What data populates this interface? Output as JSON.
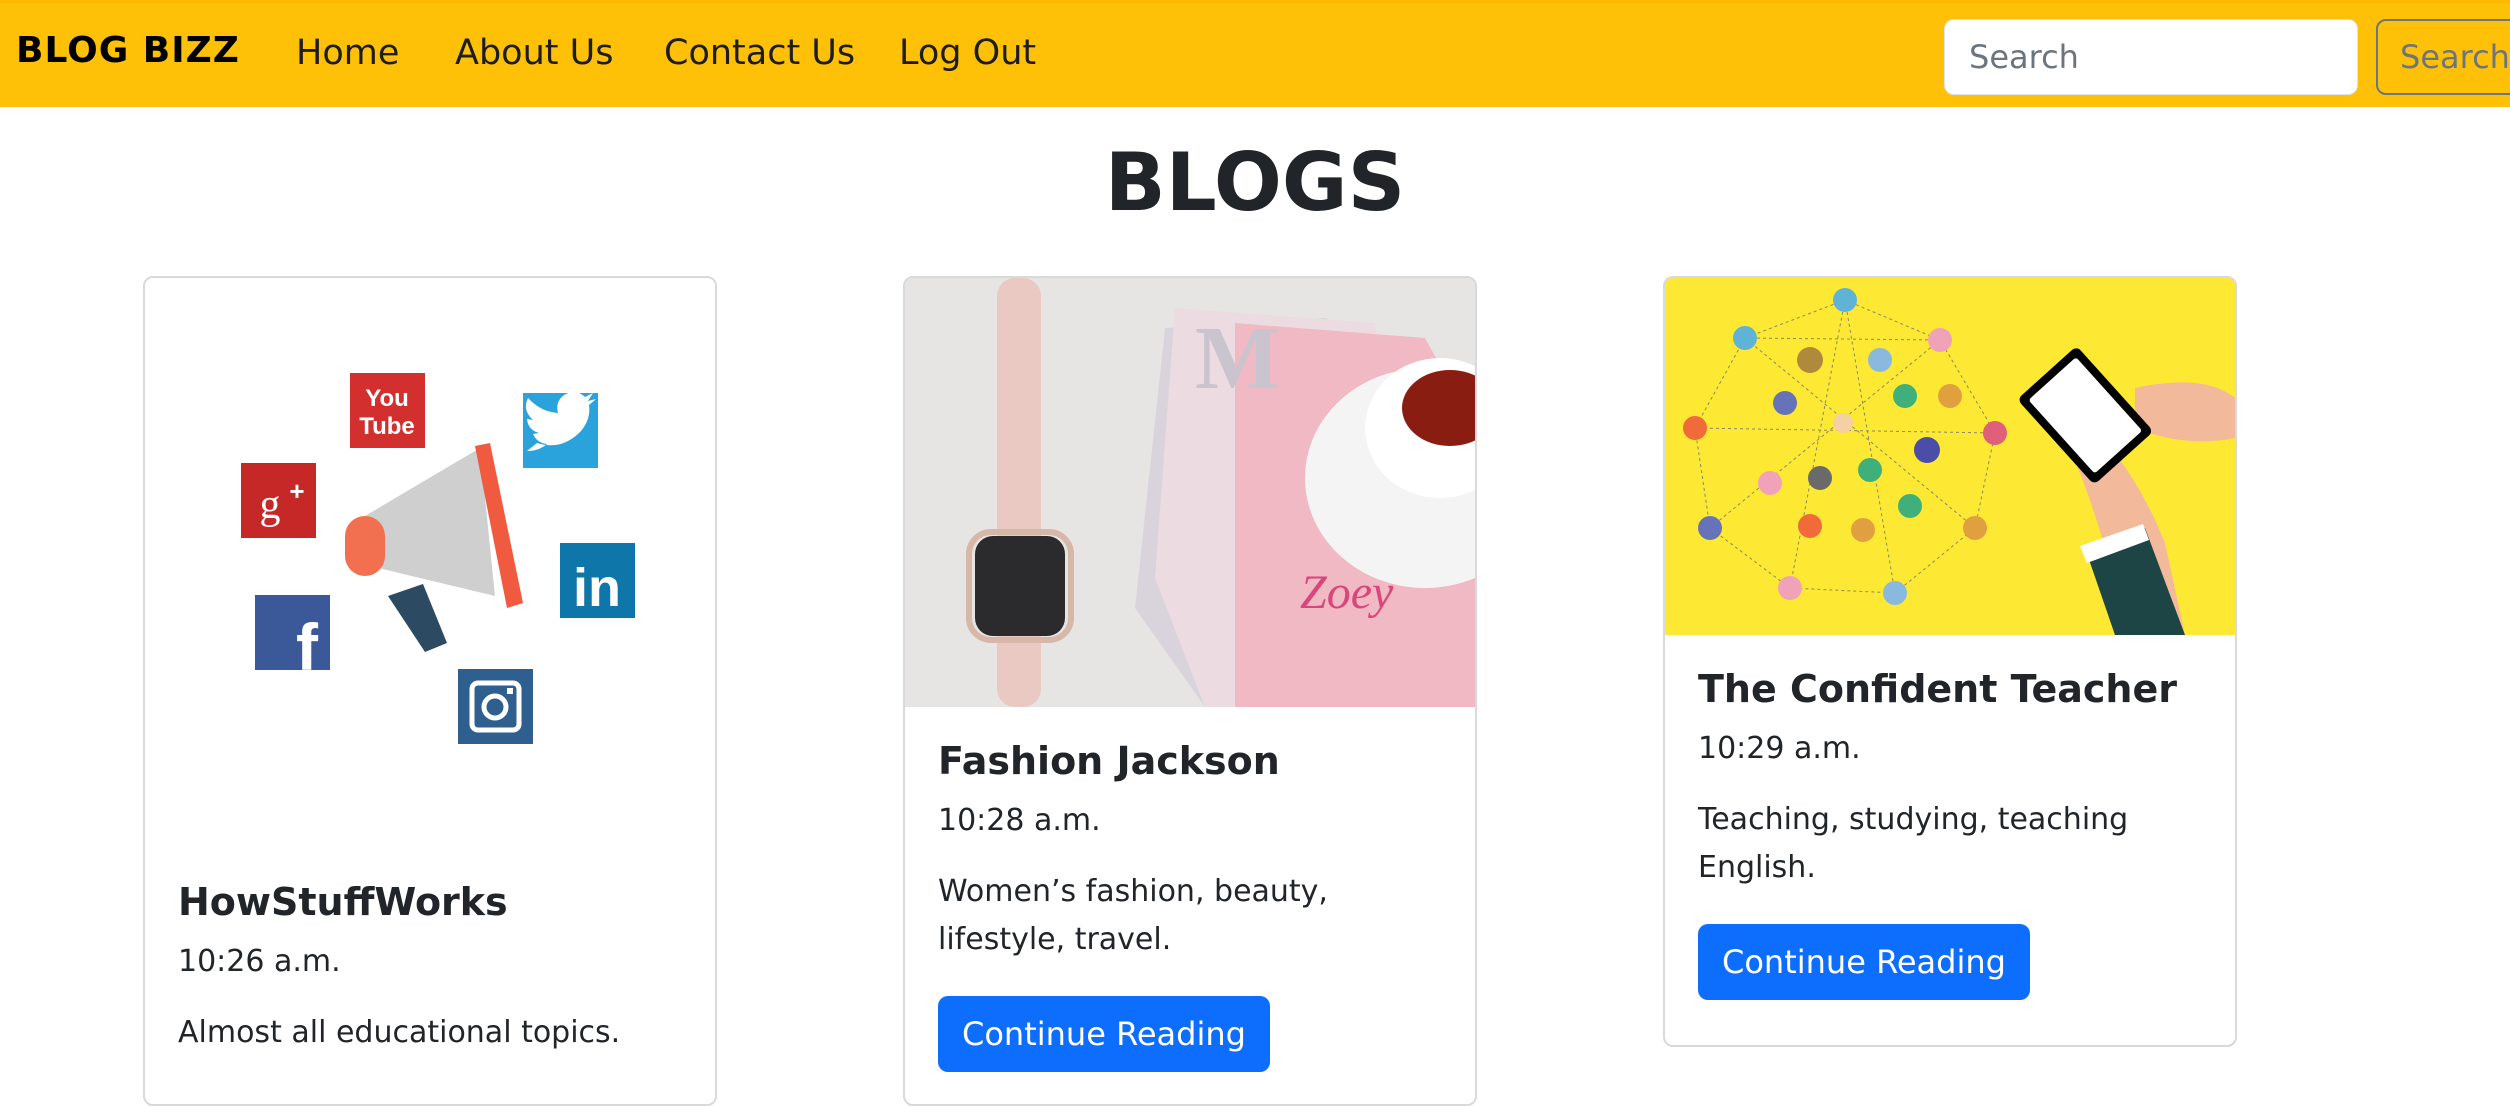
{
  "navbar": {
    "brand": "BLOG BIZZ",
    "links": [
      "Home",
      "About Us",
      "Contact Us",
      "Log Out"
    ],
    "search_placeholder": "Search",
    "search_button": "Search"
  },
  "page_title": "BLOGS",
  "cards": [
    {
      "title": "HowStuffWorks",
      "time": "10:26 a.m.",
      "description": "Almost all educational topics.",
      "image": "social-media-megaphone-illustration"
    },
    {
      "title": "Fashion Jackson",
      "time": "10:28 a.m.",
      "description": "Women’s fashion, beauty, lifestyle, travel.",
      "button": "Continue Reading",
      "image": "smartwatch-magazines-tea-photo"
    },
    {
      "title": "The Confident Teacher",
      "time": "10:29 a.m.",
      "description": "Teaching, studying, teaching English.",
      "button": "Continue Reading",
      "image": "network-people-smartphone-illustration"
    }
  ],
  "colors": {
    "navbar": "#ffc107",
    "primary_button": "#0d6efd",
    "outline_button": "#6c757d"
  }
}
